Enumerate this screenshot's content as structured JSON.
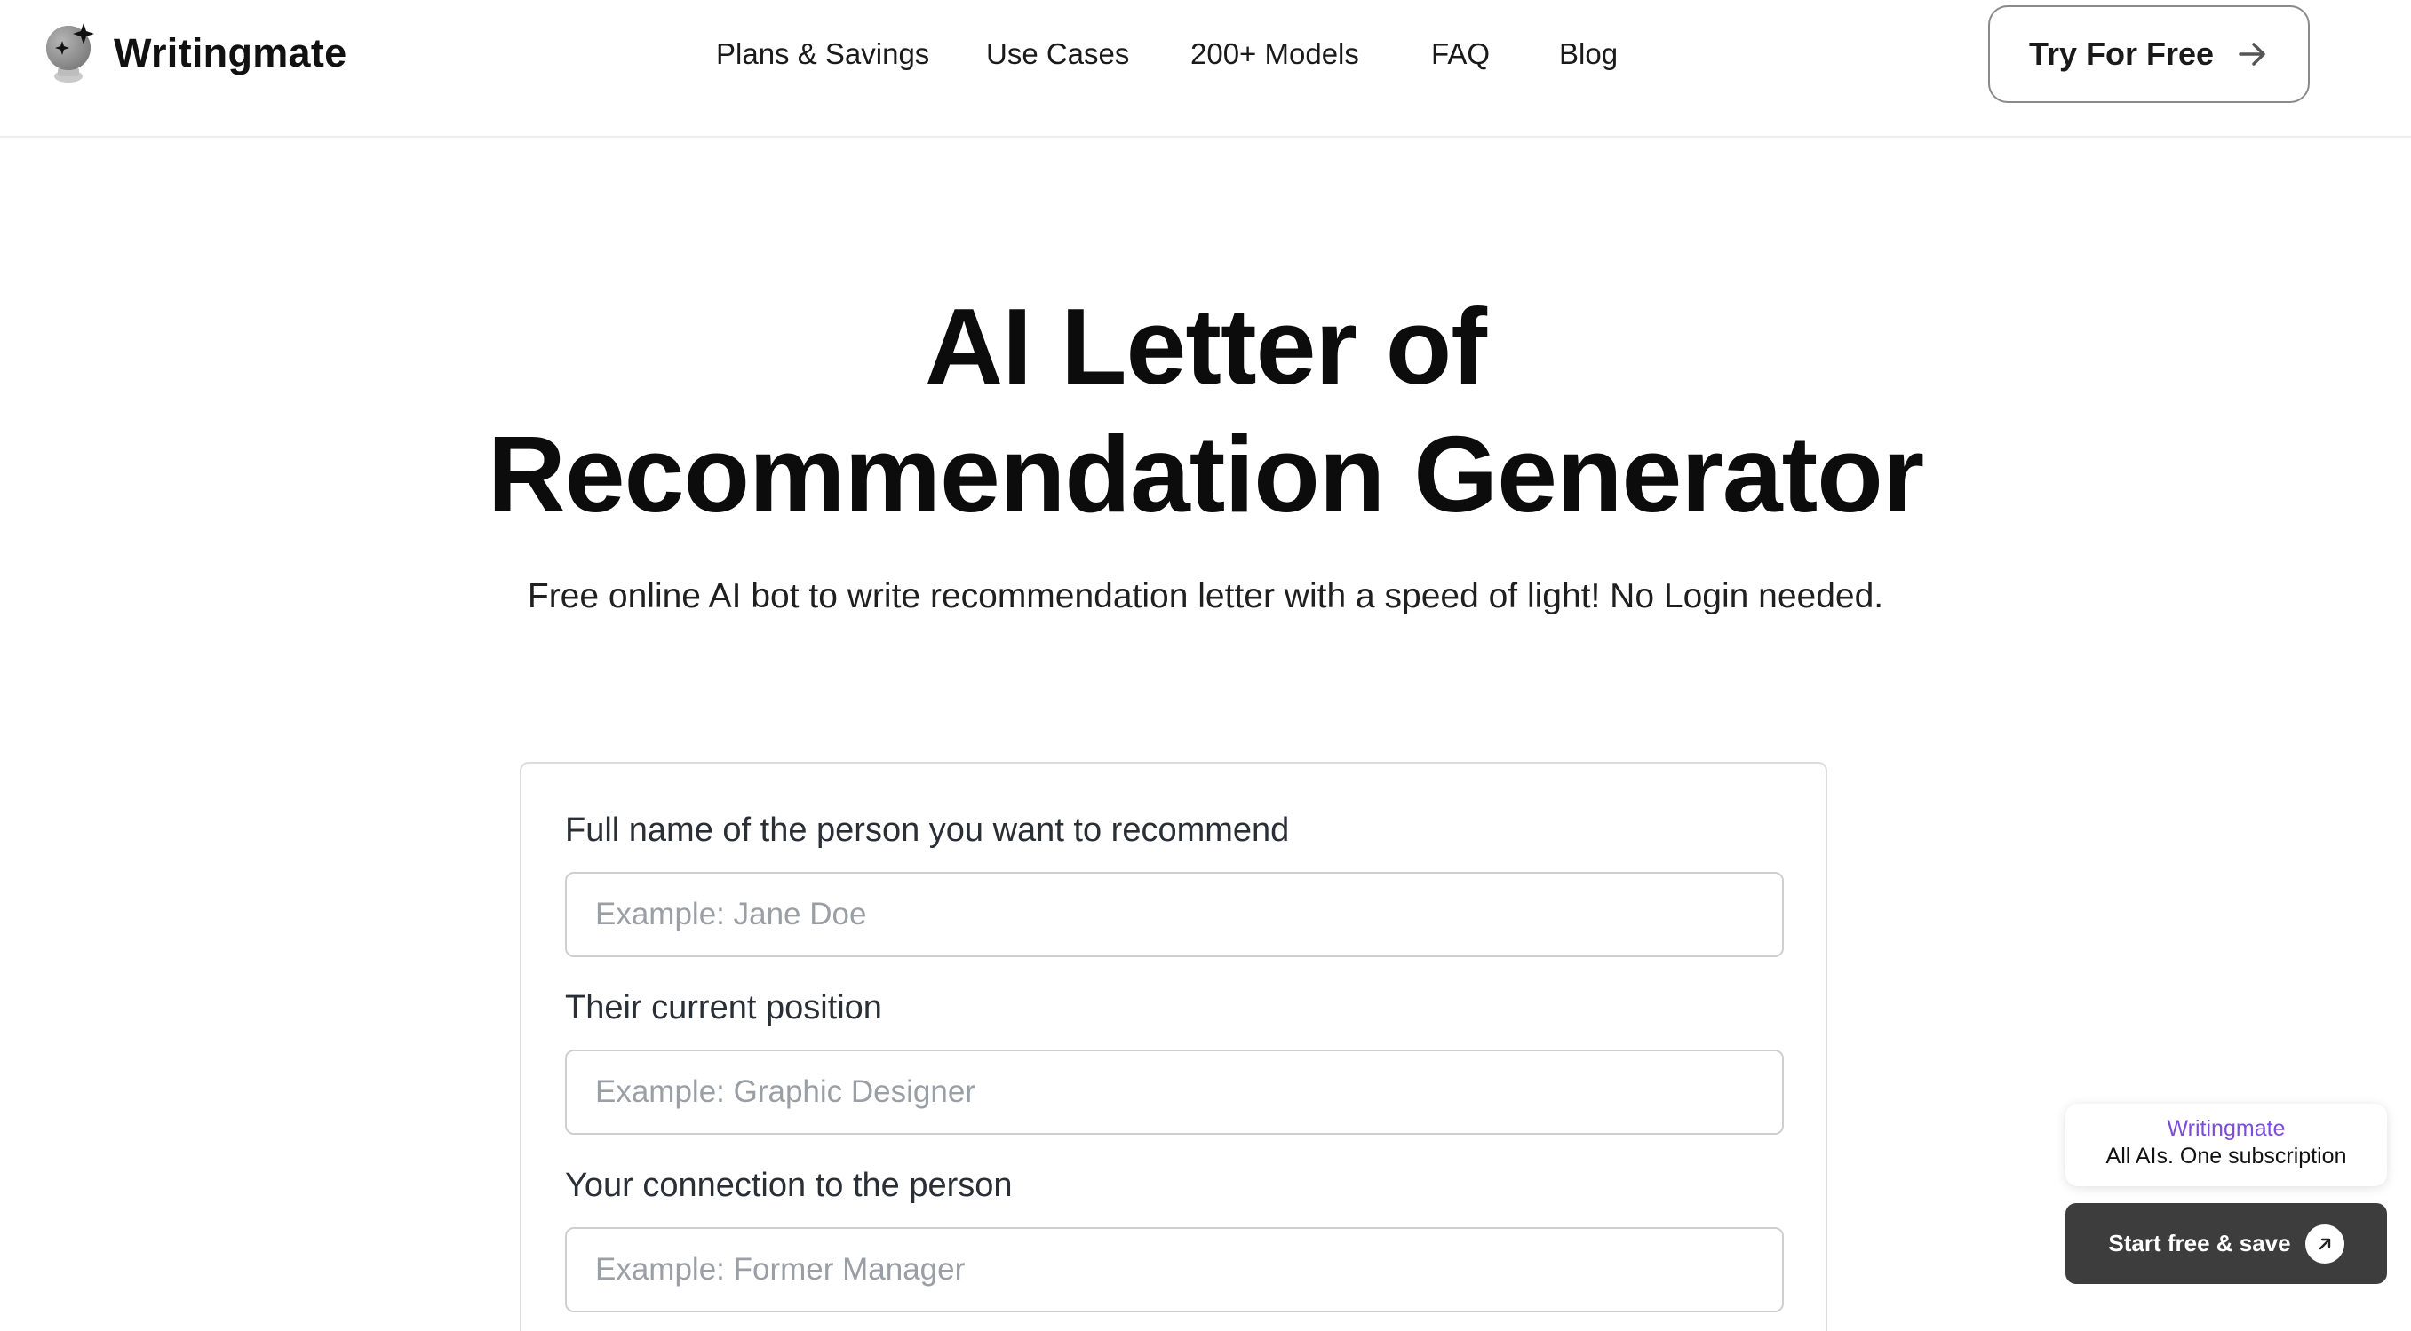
{
  "header": {
    "brand": "Writingmate",
    "nav": [
      {
        "label": "Plans & Savings"
      },
      {
        "label": "Use Cases"
      },
      {
        "label": "200+ Models"
      },
      {
        "label": "FAQ"
      },
      {
        "label": "Blog"
      }
    ],
    "cta_label": "Try For Free"
  },
  "hero": {
    "title_line1": "AI Letter of",
    "title_line2": "Recommendation Generator",
    "subtitle": "Free online AI bot to write recommendation letter with a speed of light! No Login needed."
  },
  "form": {
    "fields": [
      {
        "label": "Full name of the person you want to recommend",
        "value": "",
        "placeholder": "Example: Jane Doe"
      },
      {
        "label": "Their current position",
        "value": "",
        "placeholder": "Example: Graphic Designer"
      },
      {
        "label": "Your connection to the person",
        "value": "",
        "placeholder": "Example: Former Manager"
      }
    ]
  },
  "promo": {
    "brand": "Writingmate",
    "tagline": "All AIs. One subscription",
    "button_label": "Start free & save"
  },
  "colors": {
    "accent_purple": "#7c4ddc",
    "promo_button_bg": "#3d3d3d",
    "text_primary": "#0c0c0c"
  },
  "icons": [
    "crystal-ball-logo-icon",
    "arrow-right-icon",
    "arrow-up-right-icon"
  ]
}
